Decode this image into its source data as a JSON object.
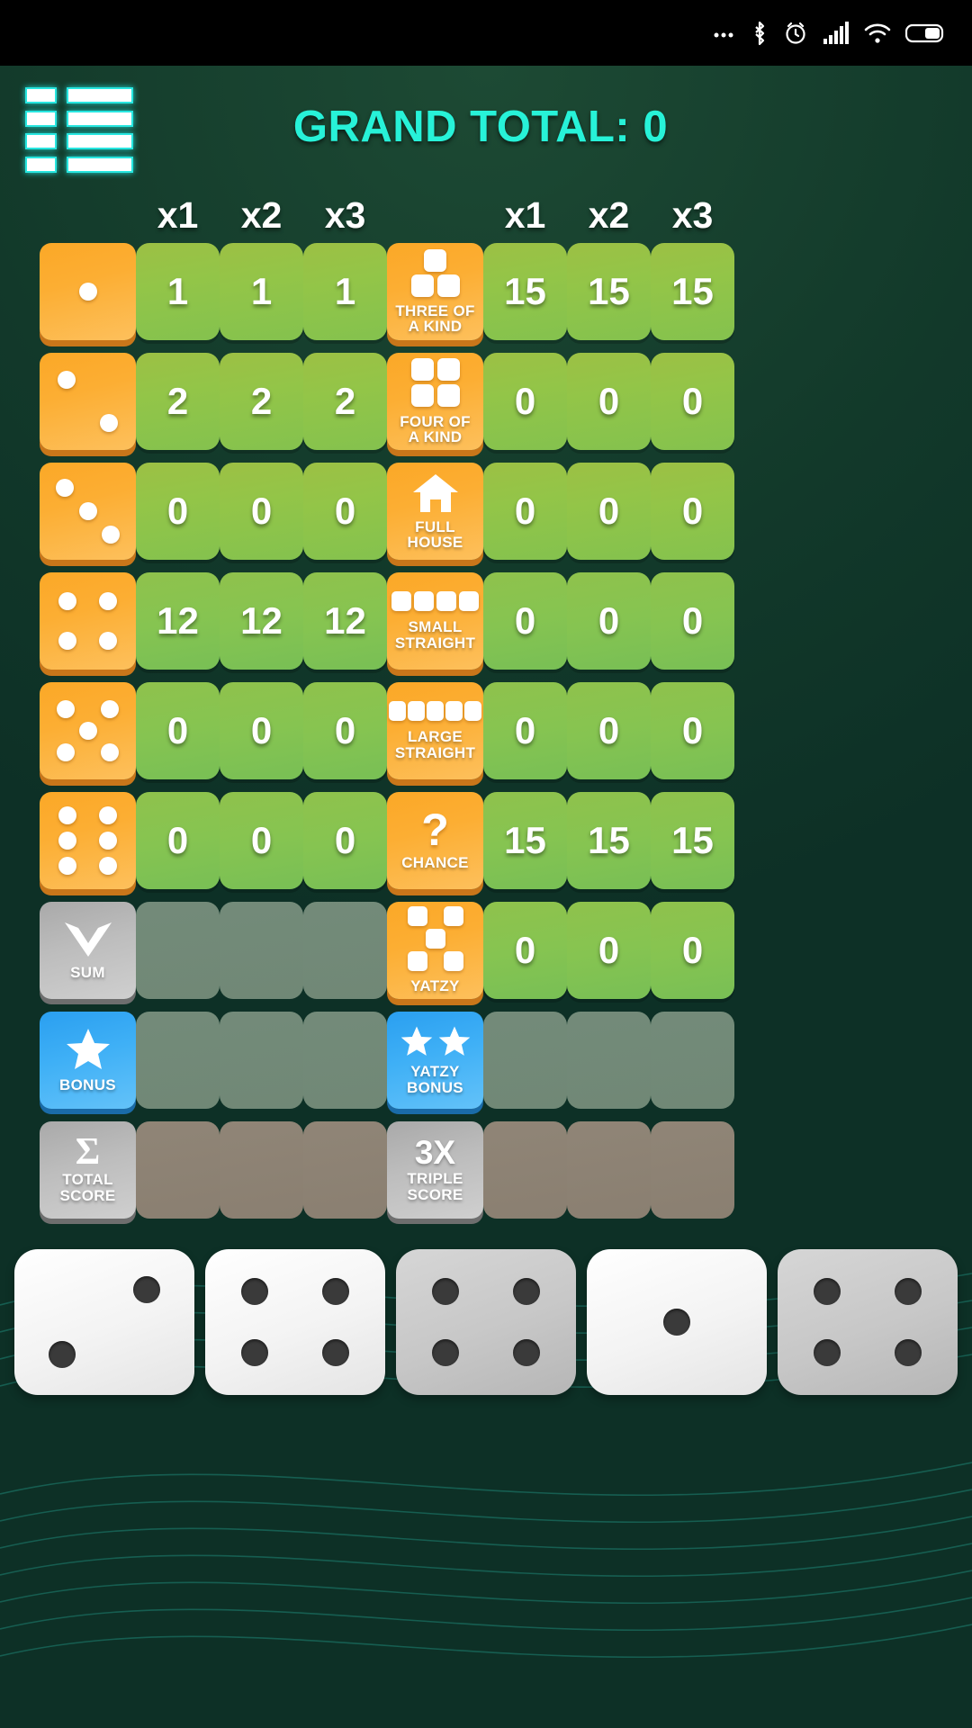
{
  "statusbar": {
    "icons": [
      "more-icon",
      "bluetooth-icon",
      "alarm-icon",
      "signal-icon",
      "wifi-icon",
      "battery-icon"
    ]
  },
  "header": {
    "menu_icon": "menu-list-icon",
    "grand_total_label": "GRAND TOTAL: 0",
    "grand_total_value": 0,
    "accent_color": "#27f2d8"
  },
  "board": {
    "left_headers": [
      "x1",
      "x2",
      "x3"
    ],
    "right_headers": [
      "x1",
      "x2",
      "x3"
    ],
    "rows": [
      {
        "left_icon": "die-1-icon",
        "left_pips": 1,
        "left_scores": [
          "1",
          "1",
          "1"
        ],
        "right_label": "THREE OF\nA KIND",
        "right_label_line1": "THREE OF",
        "right_label_line2": "A KIND",
        "right_icon": "three-of-a-kind-icon",
        "right_scores": [
          "15",
          "15",
          "15"
        ],
        "right_state": "active"
      },
      {
        "left_icon": "die-2-icon",
        "left_pips": 2,
        "left_scores": [
          "2",
          "2",
          "2"
        ],
        "right_label_line1": "FOUR OF",
        "right_label_line2": "A KIND",
        "right_icon": "four-of-a-kind-icon",
        "right_scores": [
          "0",
          "0",
          "0"
        ],
        "right_state": "active"
      },
      {
        "left_icon": "die-3-icon",
        "left_pips": 3,
        "left_scores": [
          "0",
          "0",
          "0"
        ],
        "right_label_line1": "FULL",
        "right_label_line2": "HOUSE",
        "right_icon": "full-house-icon",
        "right_scores": [
          "0",
          "0",
          "0"
        ],
        "right_state": "active"
      },
      {
        "left_icon": "die-4-icon",
        "left_pips": 4,
        "left_scores": [
          "12",
          "12",
          "12"
        ],
        "right_label_line1": "SMALL",
        "right_label_line2": "STRAIGHT",
        "right_icon": "small-straight-icon",
        "right_scores": [
          "0",
          "0",
          "0"
        ],
        "right_state": "active"
      },
      {
        "left_icon": "die-5-icon",
        "left_pips": 5,
        "left_scores": [
          "0",
          "0",
          "0"
        ],
        "right_label_line1": "LARGE",
        "right_label_line2": "STRAIGHT",
        "right_icon": "large-straight-icon",
        "right_scores": [
          "0",
          "0",
          "0"
        ],
        "right_state": "active"
      },
      {
        "left_icon": "die-6-icon",
        "left_pips": 6,
        "left_scores": [
          "0",
          "0",
          "0"
        ],
        "right_label_line1": "CHANCE",
        "right_label_line2": "",
        "right_icon": "question-mark-icon",
        "right_scores": [
          "15",
          "15",
          "15"
        ],
        "right_state": "active"
      }
    ],
    "sum_row": {
      "left_label": "SUM",
      "left_icon": "chevron-down-icon",
      "left_scores": [
        "",
        "",
        ""
      ],
      "left_state": "disabled",
      "right_label_line1": "YATZY",
      "right_label_line2": "",
      "right_icon": "yatzy-icon",
      "right_scores": [
        "0",
        "0",
        "0"
      ],
      "right_state": "active"
    },
    "bonus_row": {
      "left_label": "BONUS",
      "left_icon": "star-icon",
      "left_scores": [
        "",
        "",
        ""
      ],
      "left_state": "disabled",
      "right_label_line1": "YATZY",
      "right_label_line2": "BONUS",
      "right_icon": "double-star-icon",
      "right_scores": [
        "",
        "",
        ""
      ],
      "right_state": "disabled"
    },
    "total_row": {
      "left_label_line1": "TOTAL",
      "left_label_line2": "SCORE",
      "left_icon": "sigma-icon",
      "left_scores": [
        "",
        "",
        ""
      ],
      "left_state": "disabled",
      "right_badge": "3X",
      "right_label_line1": "TRIPLE",
      "right_label_line2": "SCORE",
      "right_scores": [
        "",
        "",
        ""
      ],
      "right_state": "disabled"
    }
  },
  "tray": {
    "dice": [
      {
        "name": "tray-die-1",
        "value": 2,
        "shade": "white"
      },
      {
        "name": "tray-die-2",
        "value": 4,
        "shade": "white"
      },
      {
        "name": "tray-die-3",
        "value": 4,
        "shade": "grey"
      },
      {
        "name": "tray-die-4",
        "value": 1,
        "shade": "white"
      },
      {
        "name": "tray-die-5",
        "value": 4,
        "shade": "grey"
      }
    ]
  }
}
